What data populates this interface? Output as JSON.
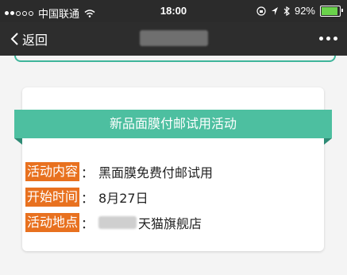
{
  "status_bar": {
    "carrier": "中国联通",
    "time": "18:00",
    "battery_percent": "92%",
    "battery_level": 0.92,
    "battery_color": "#6ad34b",
    "icons": [
      "signal-icon",
      "wifi-icon",
      "lock-rotation-icon",
      "location-icon",
      "bluetooth-icon",
      "battery-icon"
    ]
  },
  "nav_bar": {
    "back_label": "返回",
    "more_icon": "more-dots-icon",
    "background": "#2d2d2d"
  },
  "card": {
    "banner_title": "新品面膜付邮试用活动",
    "accent_color": "#4dbfa0",
    "tag_color": "#e8711f",
    "rows": [
      {
        "label": "活动内容",
        "colon": "：",
        "value": "黑面膜免费付邮试用"
      },
      {
        "label": "开始时间",
        "colon": "：",
        "value": "8月27日"
      },
      {
        "label": "活动地点",
        "colon": "：",
        "value": "天猫旗舰店"
      }
    ]
  }
}
